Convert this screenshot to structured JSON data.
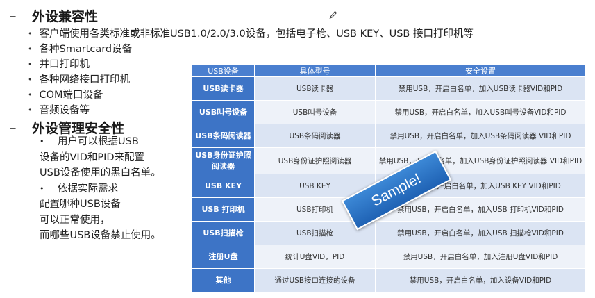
{
  "section1": {
    "dash": "–",
    "title": "外设兼容性"
  },
  "bullets": [
    "客户端使用各类标准或非标准USB1.0/2.0/3.0设备，包括电子枪、USB KEY、USB 接口打印机等",
    "各种Smartcard设备",
    "并口打印机",
    "各种网络接口打印机",
    "COM端口设备",
    "音频设备等"
  ],
  "section2": {
    "dash": "–",
    "title": "外设管理安全性"
  },
  "para_lines": [
    "用户可以根据USB",
    "设备的VID和PID来配置",
    "USB设备使用的黑白名单。",
    "依据实际需求",
    "配置哪种USB设备",
    "可以正常使用，",
    "而哪些USB设备禁止使用。"
  ],
  "table": {
    "headers": [
      "USB设备",
      "具体型号",
      "安全设置"
    ],
    "rows": [
      [
        "USB读卡器",
        "USB读卡器",
        "禁用USB，开启白名单，加入USB读卡器VID和PID"
      ],
      [
        "USB叫号设备",
        "USB叫号设备",
        "禁用USB，开启白名单，加入USB叫号设备VID和PID"
      ],
      [
        "USB条码阅读器",
        "USB条码阅读器",
        "禁用USB，开启白名单，加入USB条码阅读器 VID和PID"
      ],
      [
        "USB身份证护照阅读器",
        "USB身份证护照阅读器",
        "禁用USB，开启白名单，加入USB身份证护照阅读器 VID和PID"
      ],
      [
        "USB KEY",
        "USB KEY",
        "禁用USB，开启白名单，加入USB KEY VID和PID"
      ],
      [
        "USB 打印机",
        "USB打印机",
        "禁用USB，开启白名单，加入USB 打印机VID和PID"
      ],
      [
        "USB扫描枪",
        "USB扫描枪",
        "禁用USB，开启白名单，加入USB 扫描枪VID和PID"
      ],
      [
        "注册U盘",
        "统计U盘VID，PID",
        "禁用USB，开启白名单，加入注册U盘VID和PID"
      ],
      [
        "其他",
        "通过USB接口连接的设备",
        "禁用USB，开启白名单，加入设备VID和PID"
      ]
    ]
  },
  "watermark": "Sample!",
  "icons": {
    "edit": "pencil-icon"
  },
  "colors": {
    "header": "#4a7fcf",
    "first_col": "#3d74c6",
    "row_a": "#dbe4f3",
    "row_b": "#eef2f9",
    "stamp": "#2a73c4"
  }
}
